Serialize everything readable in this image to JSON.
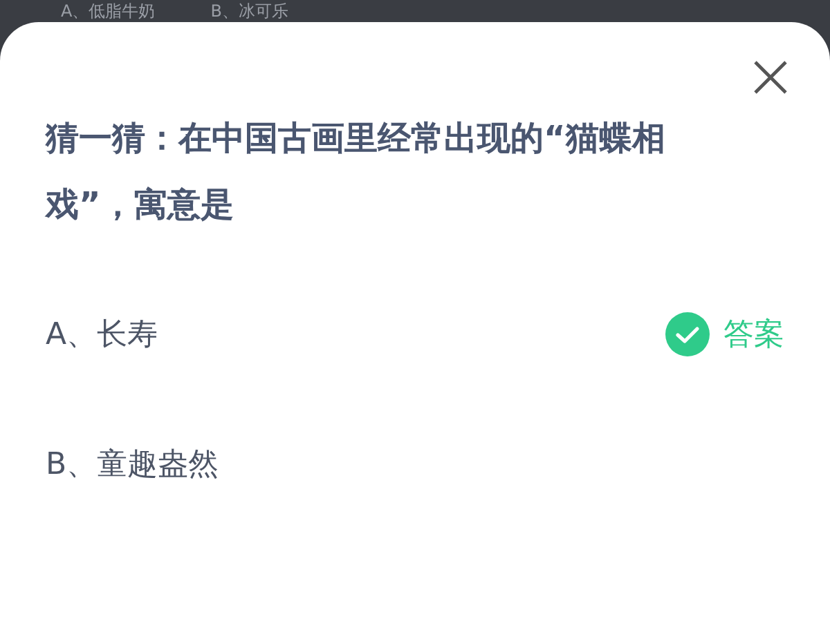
{
  "backdrop": {
    "options": [
      "A、低脂牛奶",
      "B、冰可乐"
    ]
  },
  "quiz": {
    "question": "猜一猜：在中国古画里经常出现的“猫蝶相戏”，寓意是",
    "options": [
      {
        "label": "A、长寿",
        "correct": true,
        "answer_label": "答案"
      },
      {
        "label": "B、童趣盎然",
        "correct": false
      }
    ]
  }
}
